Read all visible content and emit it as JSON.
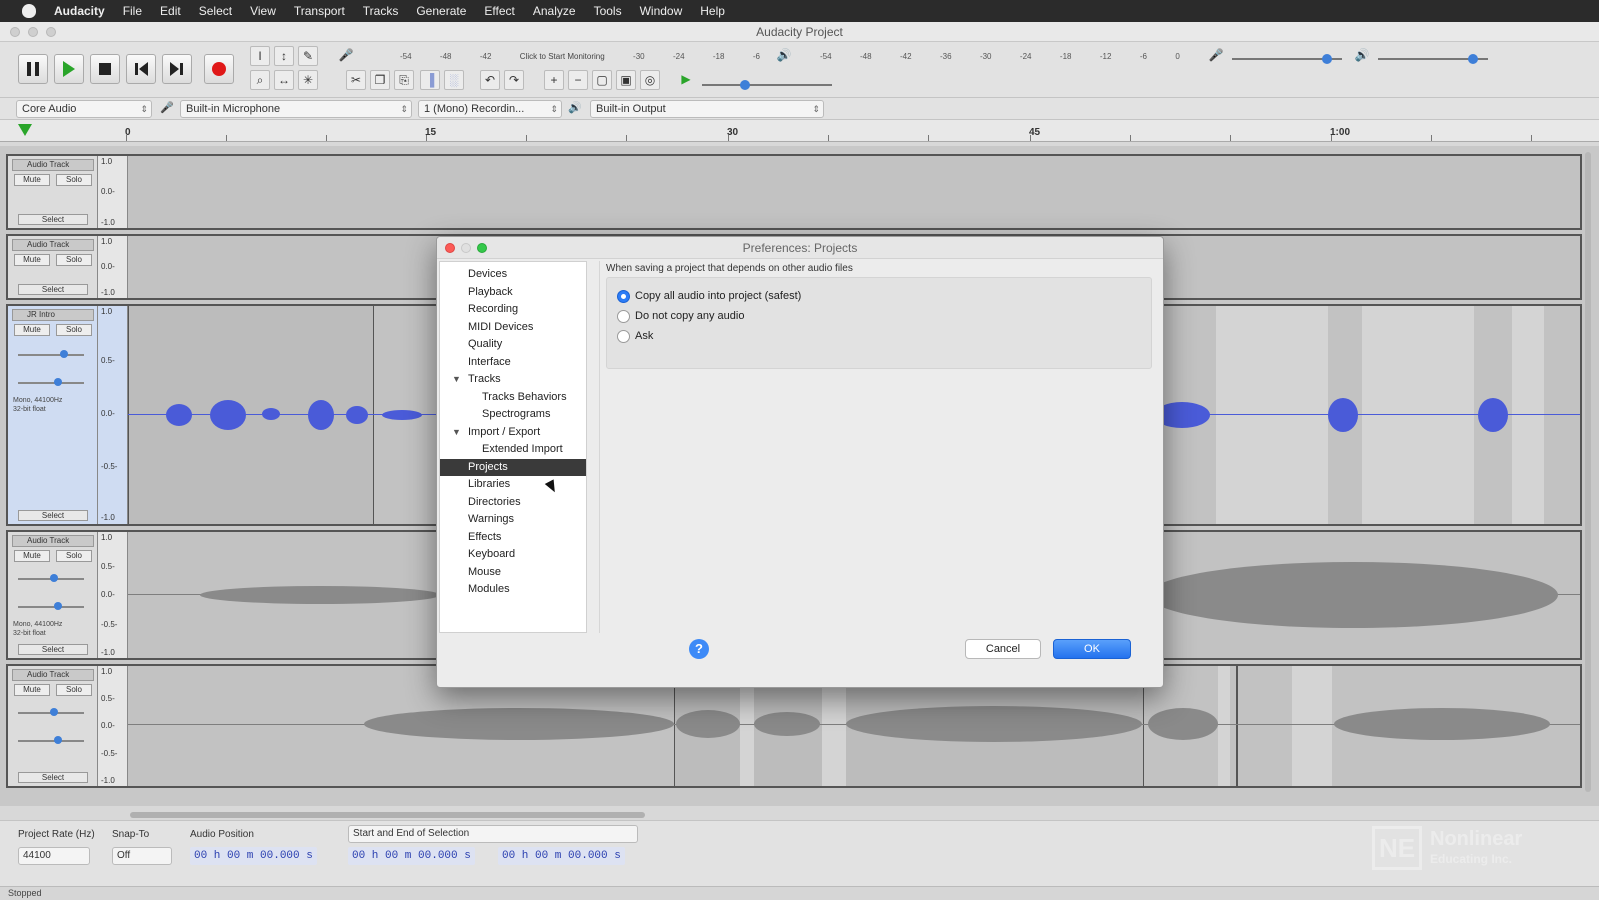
{
  "menubar": {
    "app_name": "Audacity",
    "items": [
      "File",
      "Edit",
      "Select",
      "View",
      "Transport",
      "Tracks",
      "Generate",
      "Effect",
      "Analyze",
      "Tools",
      "Window",
      "Help"
    ]
  },
  "window": {
    "title": "Audacity Project"
  },
  "toolbar": {
    "monitor_label": "Click to Start Monitoring",
    "meter_ticks": [
      "-54",
      "-48",
      "-42",
      "-36",
      "-30",
      "-24",
      "-18",
      "-12",
      "-6",
      "0"
    ],
    "record_color": "#e01818",
    "play_color": "#2aa52a"
  },
  "devices": {
    "host": "Core Audio",
    "input": "Built-in Microphone",
    "channels": "1 (Mono) Recordin...",
    "output": "Built-in Output"
  },
  "ruler": {
    "ticks": [
      "0",
      "15",
      "30",
      "45",
      "1:00"
    ]
  },
  "tracks": [
    {
      "name": "Audio Track",
      "mute": "Mute",
      "solo": "Solo",
      "select": "Select",
      "scale": [
        "1.0",
        "0.0-",
        "-1.0"
      ]
    },
    {
      "name": "Audio Track",
      "mute": "Mute",
      "solo": "Solo",
      "select": "Select",
      "scale": [
        "1.0",
        "0.0-",
        "-1.0"
      ]
    },
    {
      "name": "JR Intro",
      "mute": "Mute",
      "solo": "Solo",
      "select": "Select",
      "info1": "Mono, 44100Hz",
      "info2": "32-bit float",
      "scale": [
        "1.0",
        "0.5-",
        "0.0-",
        "-0.5-",
        "-1.0"
      ]
    },
    {
      "name": "Audio Track",
      "mute": "Mute",
      "solo": "Solo",
      "select": "Select",
      "info1": "Mono, 44100Hz",
      "info2": "32-bit float",
      "scale": [
        "1.0",
        "0.5-",
        "0.0-",
        "-0.5-",
        "-1.0"
      ]
    },
    {
      "name": "Audio Track",
      "mute": "Mute",
      "solo": "Solo",
      "select": "Select",
      "scale": [
        "1.0",
        "0.5-",
        "0.0-",
        "-0.5-",
        "-1.0"
      ]
    }
  ],
  "bottom": {
    "rate_label": "Project Rate (Hz)",
    "rate_value": "44100",
    "snap_label": "Snap-To",
    "snap_value": "Off",
    "audio_pos_label": "Audio Position",
    "audio_pos_value": "00 h 00 m 00.000 s",
    "selection_mode": "Start and End of Selection",
    "sel_start": "00 h 00 m 00.000 s",
    "sel_end": "00 h 00 m 00.000 s"
  },
  "status": "Stopped",
  "watermark": {
    "logo": "NE",
    "line1": "Nonlinear",
    "line2": "Educating Inc."
  },
  "dialog": {
    "title": "Preferences: Projects",
    "nav": [
      {
        "label": "Devices",
        "level": 0
      },
      {
        "label": "Playback",
        "level": 0
      },
      {
        "label": "Recording",
        "level": 0
      },
      {
        "label": "MIDI Devices",
        "level": 0
      },
      {
        "label": "Quality",
        "level": 0
      },
      {
        "label": "Interface",
        "level": 0
      },
      {
        "label": "Tracks",
        "level": 0,
        "expanded": true
      },
      {
        "label": "Tracks Behaviors",
        "level": 1
      },
      {
        "label": "Spectrograms",
        "level": 1
      },
      {
        "label": "Import / Export",
        "level": 0,
        "expanded": true
      },
      {
        "label": "Extended Import",
        "level": 1
      },
      {
        "label": "Projects",
        "level": 0,
        "selected": true
      },
      {
        "label": "Libraries",
        "level": 0
      },
      {
        "label": "Directories",
        "level": 0
      },
      {
        "label": "Warnings",
        "level": 0
      },
      {
        "label": "Effects",
        "level": 0
      },
      {
        "label": "Keyboard",
        "level": 0
      },
      {
        "label": "Mouse",
        "level": 0
      },
      {
        "label": "Modules",
        "level": 0
      }
    ],
    "section_header": "When saving a project that depends on other audio files",
    "options": [
      {
        "label": "Copy all audio into project (safest)",
        "selected": true
      },
      {
        "label": "Do not copy any audio",
        "selected": false
      },
      {
        "label": "Ask",
        "selected": false
      }
    ],
    "help_label": "?",
    "cancel_label": "Cancel",
    "ok_label": "OK"
  }
}
